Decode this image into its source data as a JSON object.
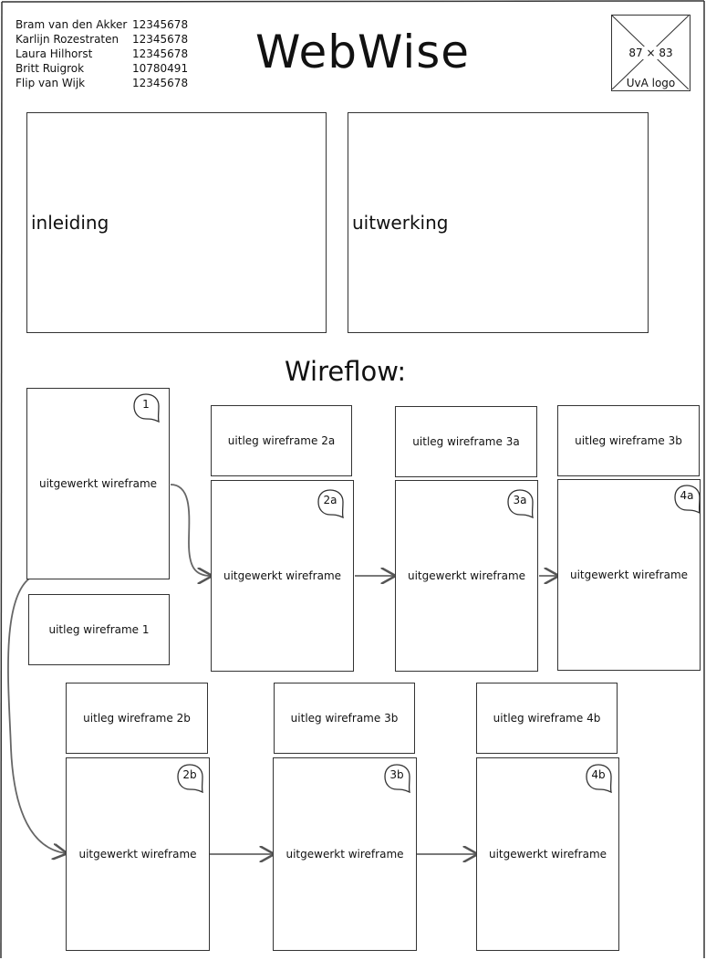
{
  "team": [
    {
      "name": "Bram van den Akker",
      "id": "12345678"
    },
    {
      "name": "Karlijn Rozestraten",
      "id": "12345678"
    },
    {
      "name": "Laura Hilhorst",
      "id": "12345678"
    },
    {
      "name": "Britt Ruigrok",
      "id": "10780491"
    },
    {
      "name": "Flip van Wijk",
      "id": "12345678"
    }
  ],
  "title": "WebWise",
  "logo": {
    "size_text": "87 × 83",
    "label": "UvA logo"
  },
  "intro_label": "inleiding",
  "work_label": "uitwerking",
  "section_title": "Wireflow:",
  "wireframe_text": "uitgewerkt wireframe",
  "badges": {
    "w1": "1",
    "w2a": "2a",
    "w3a": "3a",
    "w4a": "4a",
    "w2b": "2b",
    "w3b": "3b",
    "w4b": "4b"
  },
  "explanations": {
    "e1": "uitleg wireframe 1",
    "e2a": "uitleg wireframe 2a",
    "e3a": "uitleg wireframe 3a",
    "e4a": "uitleg wireframe 3b",
    "e2b": "uitleg wireframe 2b",
    "e3b": "uitleg wireframe 3b",
    "e4b": "uitleg wireframe 4b"
  }
}
